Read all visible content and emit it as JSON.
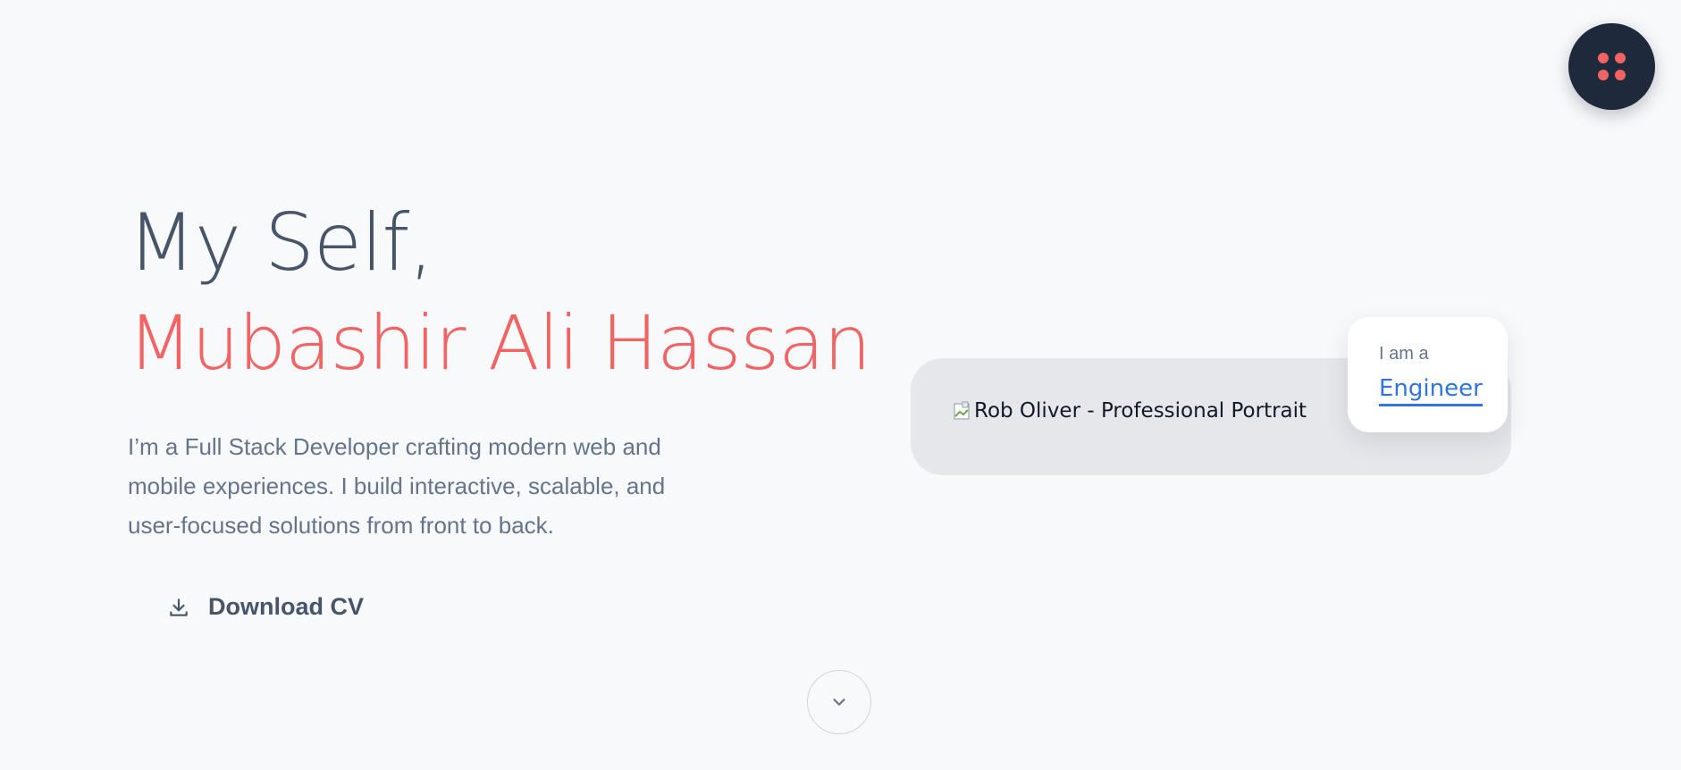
{
  "menu": {
    "icon": "grid-dots-icon",
    "dot_color": "#f26464"
  },
  "hero": {
    "greeting": "My Self,",
    "name": "Mubashir Ali Hassan",
    "intro": "I’m a Full Stack Developer crafting modern web and mobile experiences. I build interactive, scalable, and user-focused solutions from front to back.",
    "cv_button_label": "Download CV",
    "cv_icon": "download-icon"
  },
  "portrait": {
    "alt_text": "Rob Oliver - Professional Portrait",
    "icon": "broken-image-icon"
  },
  "role": {
    "prefix": "I am a",
    "word": "Engineer"
  },
  "scroll": {
    "icon": "chevron-down-icon"
  },
  "colors": {
    "accent": "#f26464",
    "link": "#2f74e0",
    "dark": "#1e293b"
  }
}
